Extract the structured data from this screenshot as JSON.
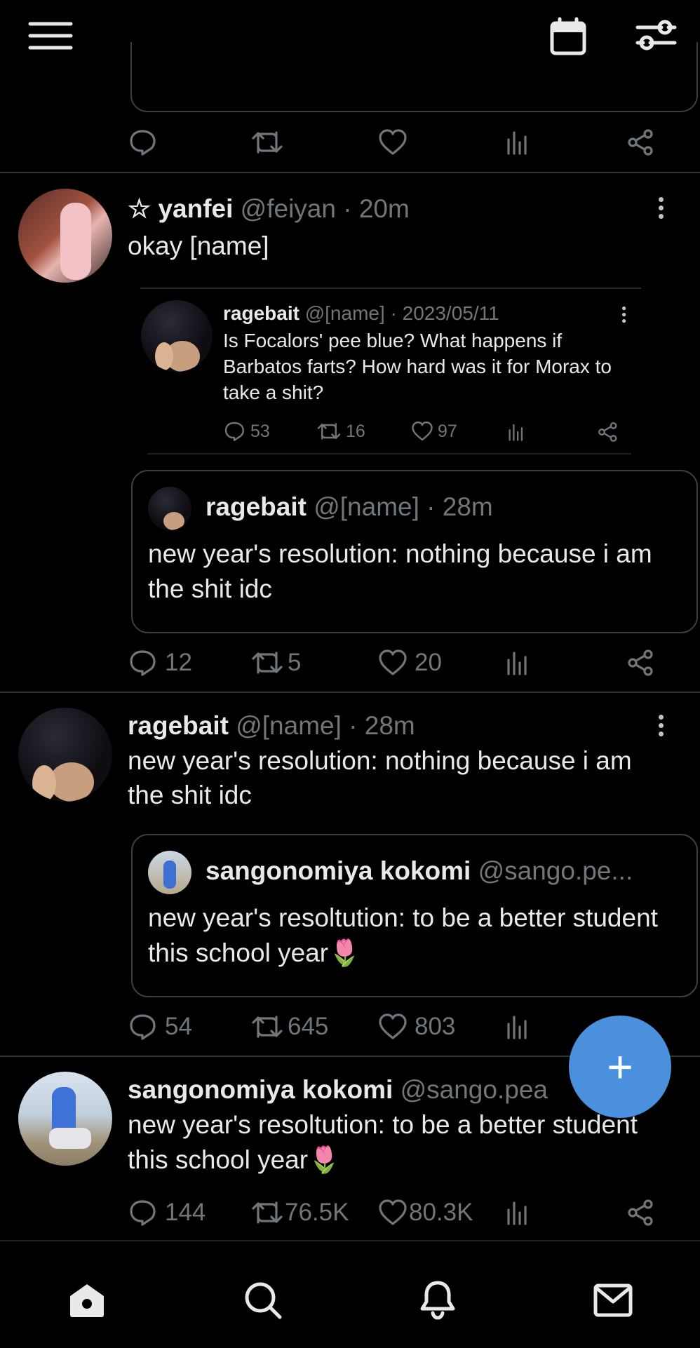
{
  "colors": {
    "background": "#000000",
    "accent": "#4a90dd",
    "text": "#e7e9ea",
    "muted": "#71767b"
  },
  "topbar": {
    "menu_icon": "hamburger-icon",
    "calendar_icon": "calendar-icon",
    "filter_icon": "sliders-icon"
  },
  "post1": {
    "star": "☆",
    "name": "yanfei",
    "handle": "@feiyan · 20m",
    "text": "okay [name]",
    "inner": {
      "name": "ragebait",
      "handle": "@[name] · 2023/05/11",
      "text": "Is Focalors' pee blue? What happens if Barbatos farts? How hard was it for Morax to take a shit?",
      "replies": "53",
      "reposts": "16",
      "likes": "97"
    },
    "quote": {
      "name": "ragebait",
      "handle": "@[name] · 28m",
      "text": "new year's resolution: nothing because i am the shit idc"
    },
    "replies": "12",
    "reposts": "5",
    "likes": "20"
  },
  "post2": {
    "name": "ragebait",
    "handle": "@[name] · 28m",
    "text": "new year's resolution: nothing because i am the shit idc",
    "quote": {
      "name": "sangonomiya kokomi",
      "handle": "@sango.pe...",
      "text": "new year's resoltution: to be a better student this school year🌷"
    },
    "replies": "54",
    "reposts": "645",
    "likes": "803"
  },
  "post3": {
    "name": "sangonomiya kokomi",
    "handle": "@sango.pea",
    "text": "new year's resoltution: to be a better student this school year🌷",
    "replies": "144",
    "reposts": "76.5K",
    "likes": "80.3K"
  },
  "fab": {
    "label": "+"
  },
  "bottom_nav": [
    "home-icon",
    "search-icon",
    "bell-icon",
    "mail-icon"
  ]
}
